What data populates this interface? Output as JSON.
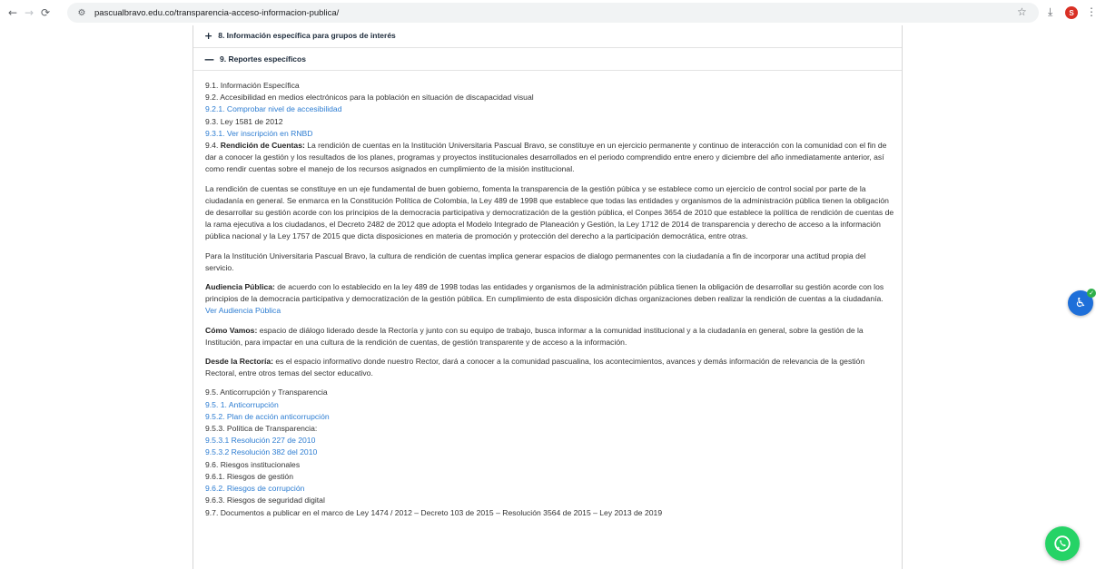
{
  "browser": {
    "url": "pascualbravo.edu.co/transparencia-acceso-informacion-publica/",
    "profile_initial": "S",
    "icons": {
      "back": "←",
      "forward": "→",
      "reload": "⟳",
      "site_info": "⚙",
      "star": "☆",
      "download": "⤓",
      "menu": "⋮"
    }
  },
  "accordion": {
    "item8": {
      "sign": "+",
      "title": "8. Información específica para grupos de interés"
    },
    "item9": {
      "sign": "—",
      "title": "9. Reportes específicos"
    }
  },
  "section9": {
    "l1": "9.1. Información Específica",
    "l2": "9.2. Accesibilidad en medios electrónicos para la población en situación de discapacidad visual",
    "l3_link": "9.2.1. Comprobar nivel de accesibilidad",
    "l4": "9.3. Ley 1581 de 2012",
    "l5_link": "9.3.1. Ver inscripción en RNBD",
    "rendicion_prefix": "9.4. ",
    "rendicion_bold": "Rendición de Cuentas:",
    "rendicion_text": " La rendición de cuentas en la Institución Universitaria Pascual Bravo, se constituye en un ejercicio permanente y continuo de interacción con la comunidad con el fin de dar a conocer la gestión y los resultados de los planes, programas y proyectos institucionales desarrollados en el periodo comprendido entre enero y diciembre del año inmediatamente anterior, así como rendir cuentas sobre el manejo de los recursos asignados en cumplimiento de la misión institucional.",
    "p2": "La rendición de cuentas se constituye en un eje fundamental de buen gobierno, fomenta la transparencia de la gestión púbica y se establece como un ejercicio de control social por parte de la ciudadanía en general. Se enmarca en la Constitución Política de Colombia, la Ley 489 de 1998 que establece que todas las entidades y organismos de la administración pública tienen la obligación de desarrollar su gestión acorde con los principios de la democracia participativa y democratización de la gestión pública, el Conpes 3654 de 2010 que establece la política de rendición de cuentas de la rama ejecutiva a los ciudadanos, el Decreto 2482 de 2012 que adopta el Modelo Integrado de Planeación y Gestión, la Ley 1712 de 2014 de transparencia y derecho de acceso a la información pública nacional y la Ley 1757 de 2015 que dicta disposiciones en materia de promoción y protección del derecho a la participación democrática, entre otras.",
    "p3": "Para la Institución Universitaria Pascual Bravo, la cultura de rendición de cuentas implica generar espacios de dialogo permanentes con la ciudadanía a fin de incorporar una actitud propia del servicio.",
    "audiencia_bold": "Audiencia Pública:",
    "audiencia_text": " de acuerdo con lo establecido en la ley 489 de 1998 todas las entidades y organismos de la administración pública tienen la obligación de desarrollar su gestión acorde con los principios de la democracia participativa y democratización de la gestión pública. En cumplimiento de esta disposición dichas organizaciones deben realizar la rendición de cuentas a la ciudadanía.",
    "audiencia_link": "Ver Audiencia Pública",
    "como_bold": "Cómo Vamos:",
    "como_text": " espacio de diálogo liderado desde la Rectoría y junto con su equipo de trabajo, busca informar a la comunidad institucional y a la ciudadanía en general, sobre la gestión de la Institución, para impactar en una cultura de la rendición de cuentas, de gestión transparente y de acceso a la información.",
    "desde_bold": "Desde la Rectoría:",
    "desde_text": " es el espacio informativo donde nuestro Rector, dará a conocer a la comunidad pascualina, los acontecimientos, avances y demás información de relevancia de la gestión Rectoral, entre otros temas del sector educativo.",
    "a1": "9.5. Anticorrupción y Transparencia",
    "a2_link": "9.5. 1. Anticorrupción",
    "a3_link": "9.5.2. Plan de acción anticorrupción",
    "a4": "9.5.3. Política de Transparencia:",
    "a5_link": "9.5.3.1 Resolución 227 de 2010",
    "a6_link": "9.5.3.2 Resolución 382 del 2010",
    "a7": "9.6. Riesgos institucionales",
    "a8": "9.6.1. Riesgos de gestión",
    "a9_link": "9.6.2. Riesgos de corrupción",
    "a10": "9.6.3. Riesgos de seguridad digital",
    "a11": "9.7. Documentos a publicar en el marco de Ley 1474 / 2012 – Decreto 103 de 2015 – Resolución 3564 de 2015 – Ley 2013 de 2019"
  },
  "widgets": {
    "accessibility_icon": "♿",
    "badge_icon": "✓"
  },
  "colors": {
    "link": "#2d7dd2",
    "accessibility": "#1e6fd9",
    "whatsapp": "#25d366"
  }
}
